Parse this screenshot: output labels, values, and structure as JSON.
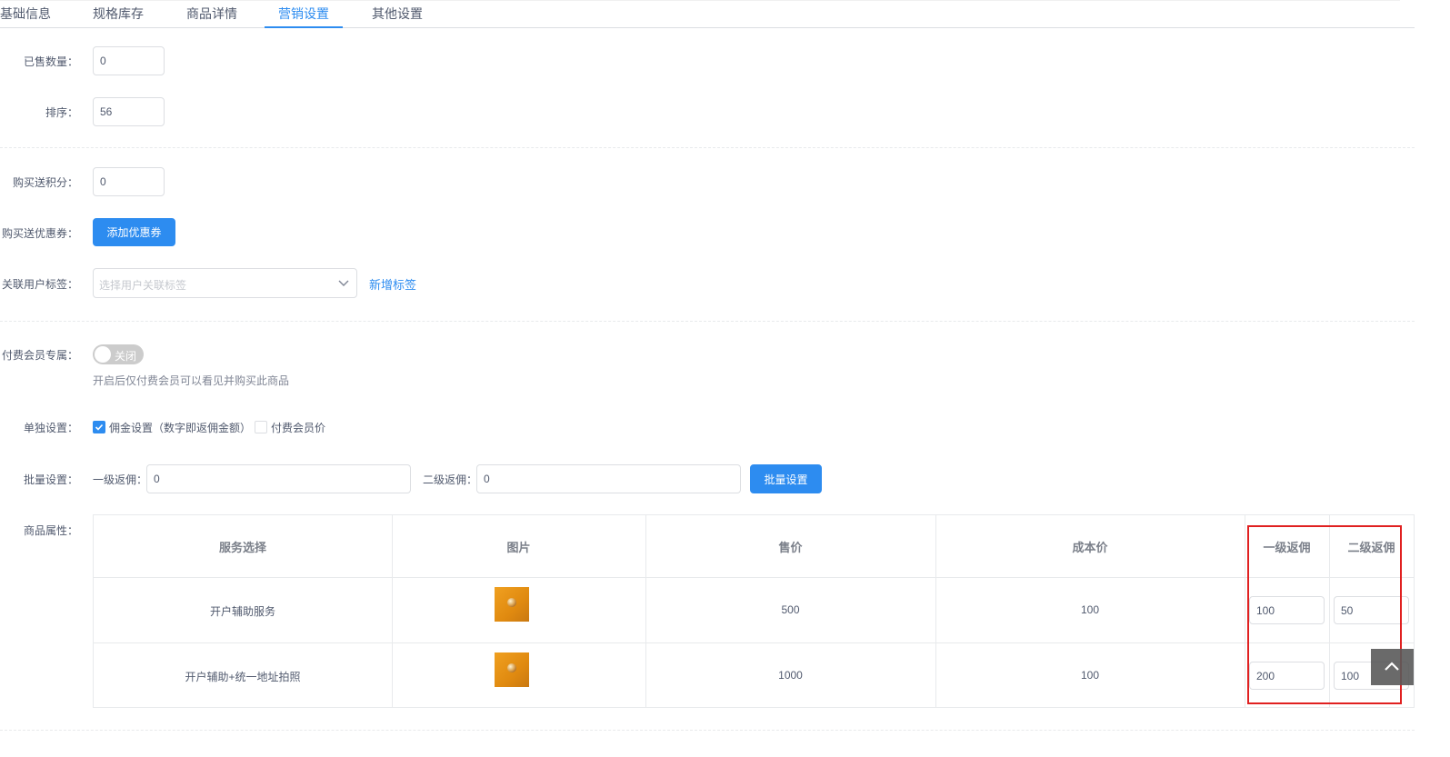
{
  "tabs": [
    {
      "label": "基础信息",
      "active": false
    },
    {
      "label": "规格库存",
      "active": false
    },
    {
      "label": "商品详情",
      "active": false
    },
    {
      "label": "营销设置",
      "active": true
    },
    {
      "label": "其他设置",
      "active": false
    }
  ],
  "form": {
    "sold_count": {
      "label": "已售数量：",
      "value": "0"
    },
    "sort": {
      "label": "排序：",
      "value": "56"
    },
    "points": {
      "label": "购买送积分：",
      "value": "0"
    },
    "coupon": {
      "label": "购买送优惠券：",
      "button": "添加优惠券"
    },
    "user_tag": {
      "label": "关联用户标签：",
      "placeholder": "选择用户关联标签",
      "add_link": "新增标签"
    },
    "paid_member": {
      "label": "付费会员专属：",
      "switch_text": "关闭",
      "switch_on": false,
      "hint": "开启后仅付费会员可以看见并购买此商品"
    },
    "single": {
      "label": "单独设置：",
      "commission": {
        "label": "佣金设置（数字即返佣金额）",
        "checked": true
      },
      "member_price": {
        "label": "付费会员价",
        "checked": false
      }
    },
    "batch": {
      "label": "批量设置：",
      "level1_label": "一级返佣：",
      "level1_value": "0",
      "level2_label": "二级返佣：",
      "level2_value": "0",
      "button": "批量设置"
    },
    "attrs": {
      "label": "商品属性：",
      "headers": [
        "服务选择",
        "图片",
        "售价",
        "成本价",
        "一级返佣",
        "二级返佣"
      ],
      "rows": [
        {
          "service": "开户辅助服务",
          "price": "500",
          "cost": "100",
          "level1": "100",
          "level2": "50"
        },
        {
          "service": "开户辅助+统一地址拍照",
          "price": "1000",
          "cost": "100",
          "level1": "200",
          "level2": "100"
        }
      ]
    }
  },
  "colors": {
    "primary": "#2d8cf0",
    "highlight": "#e02020"
  },
  "icons": {
    "select_arrow": "chevron-down-icon",
    "back_to_top": "chevron-up-icon"
  }
}
